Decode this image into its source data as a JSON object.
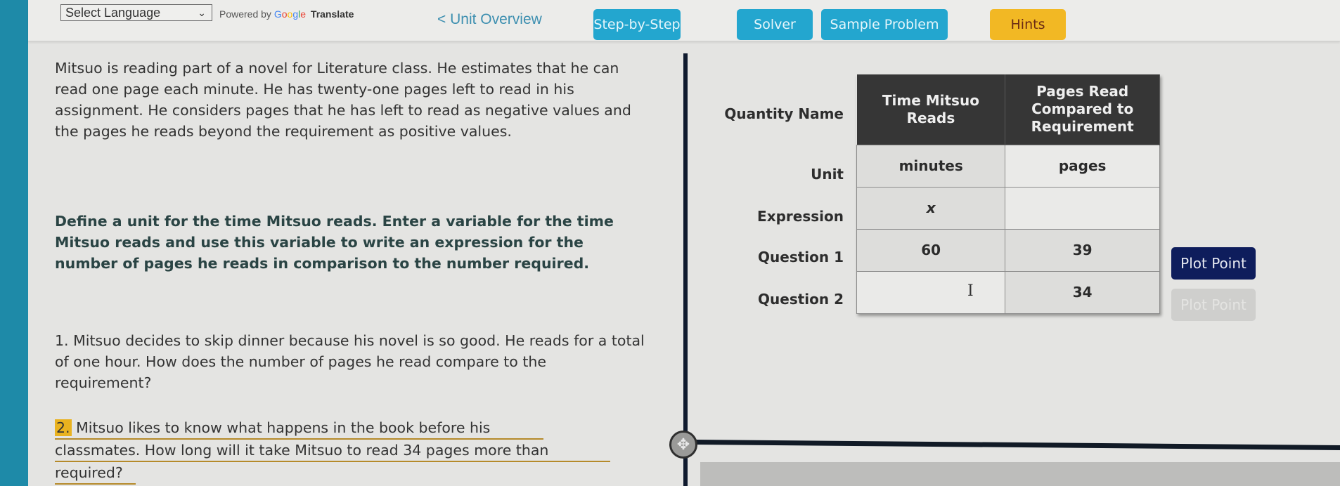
{
  "toolbar": {
    "language_select": {
      "value": "Select Language",
      "icon": "chevron-down-icon"
    },
    "powered_by": "Powered by",
    "google": [
      "G",
      "o",
      "o",
      "g",
      "l",
      "e"
    ],
    "translate": "Translate",
    "unit_overview_link": "< Unit Overview",
    "buttons": {
      "step_by_step": "Step-by-Step",
      "solver": "Solver",
      "sample_problem": "Sample Problem",
      "hints": "Hints"
    }
  },
  "problem": {
    "text": "Mitsuo is reading part of a novel for Literature class. He estimates that he can read one page each minute. He has twenty-one pages left to read in his assignment. He considers pages that he has left to read as negative values and the pages he reads beyond the requirement as positive values.",
    "instructions": "Define a unit for the time Mitsuo reads. Enter a variable for the time Mitsuo reads and use this variable to write an expression for the number of pages he reads in comparison to the number required.",
    "question_1": "1. Mitsuo decides to skip dinner because his novel is so good. He reads for a total of one hour. How does the number of pages he read compare to the requirement?",
    "question_2": {
      "number": "2.",
      "line1": "Mitsuo likes to know what happens in the book before his",
      "line2": "classmates. How long will it take Mitsuo to read 34 pages more than",
      "line3": "required?"
    }
  },
  "table": {
    "row_labels": {
      "quantity_name": "Quantity Name",
      "unit": "Unit",
      "expression": "Expression",
      "question_1": "Question 1",
      "question_2": "Question 2"
    },
    "headers": {
      "col1": "Time Mitsuo Reads",
      "col2": "Pages Read Compared to Requirement"
    },
    "unit": {
      "col1": "minutes",
      "col2": "pages"
    },
    "expression": {
      "col1": "x",
      "col2": ""
    },
    "question_1": {
      "col1": "60",
      "col2": "39"
    },
    "question_2": {
      "col1": "",
      "col2": "34"
    },
    "cursor_glyph": "I"
  },
  "plot_buttons": {
    "plot_1": "Plot Point",
    "plot_2": "Plot Point"
  },
  "split_handle": {
    "icon": "move-icon",
    "glyph": "✥"
  },
  "colors": {
    "teal_bar": "#1e8aa8",
    "tool_button": "#23a6cf",
    "hints_button": "#f2b824",
    "plot_button": "#0e1d5c",
    "plot_button_disabled": "#cfcfcd",
    "table_header": "#363636",
    "highlight": "#e9b21f"
  }
}
